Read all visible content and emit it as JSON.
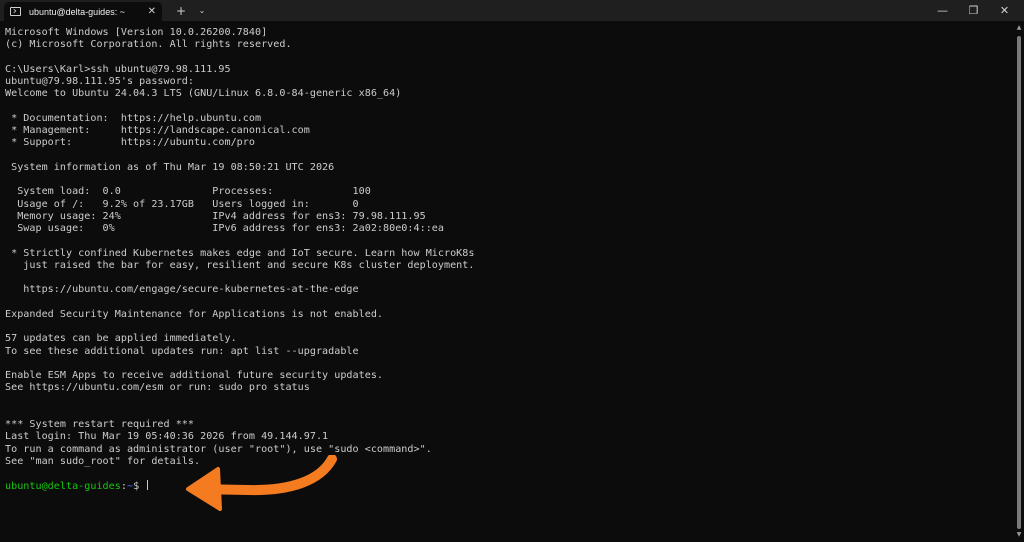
{
  "window": {
    "tab_title": "ubuntu@delta-guides: ~",
    "tab_close": "✕",
    "new_tab": "+",
    "dropdown": "⌄",
    "minimize": "—",
    "maximize": "❐",
    "close": "✕"
  },
  "terminal": {
    "lines": [
      "Microsoft Windows [Version 10.0.26200.7840]",
      "(c) Microsoft Corporation. All rights reserved.",
      "",
      "C:\\Users\\Karl>ssh ubuntu@79.98.111.95",
      "ubuntu@79.98.111.95's password:",
      "Welcome to Ubuntu 24.04.3 LTS (GNU/Linux 6.8.0-84-generic x86_64)",
      "",
      " * Documentation:  https://help.ubuntu.com",
      " * Management:     https://landscape.canonical.com",
      " * Support:        https://ubuntu.com/pro",
      "",
      " System information as of Thu Mar 19 08:50:21 UTC 2026",
      "",
      "  System load:  0.0               Processes:             100",
      "  Usage of /:   9.2% of 23.17GB   Users logged in:       0",
      "  Memory usage: 24%               IPv4 address for ens3: 79.98.111.95",
      "  Swap usage:   0%                IPv6 address for ens3: 2a02:80e0:4::ea",
      "",
      " * Strictly confined Kubernetes makes edge and IoT secure. Learn how MicroK8s",
      "   just raised the bar for easy, resilient and secure K8s cluster deployment.",
      "",
      "   https://ubuntu.com/engage/secure-kubernetes-at-the-edge",
      "",
      "Expanded Security Maintenance for Applications is not enabled.",
      "",
      "57 updates can be applied immediately.",
      "To see these additional updates run: apt list --upgradable",
      "",
      "Enable ESM Apps to receive additional future security updates.",
      "See https://ubuntu.com/esm or run: sudo pro status",
      "",
      "",
      "*** System restart required ***",
      "Last login: Thu Mar 19 05:40:36 2026 from 49.144.97.1",
      "To run a command as administrator (user \"root\"), use \"sudo <command>\".",
      "See \"man sudo_root\" for details.",
      ""
    ],
    "prompt": {
      "user_host": "ubuntu@delta-guides",
      "separator": ":",
      "path": "~",
      "symbol": "$ "
    }
  },
  "annotation": {
    "arrow_color": "#f47b20",
    "icon": "arrow-pointing-left"
  },
  "colors": {
    "background": "#0c0c0c",
    "text": "#cccccc",
    "prompt_user": "#16c60c",
    "prompt_path": "#3b78ff"
  }
}
